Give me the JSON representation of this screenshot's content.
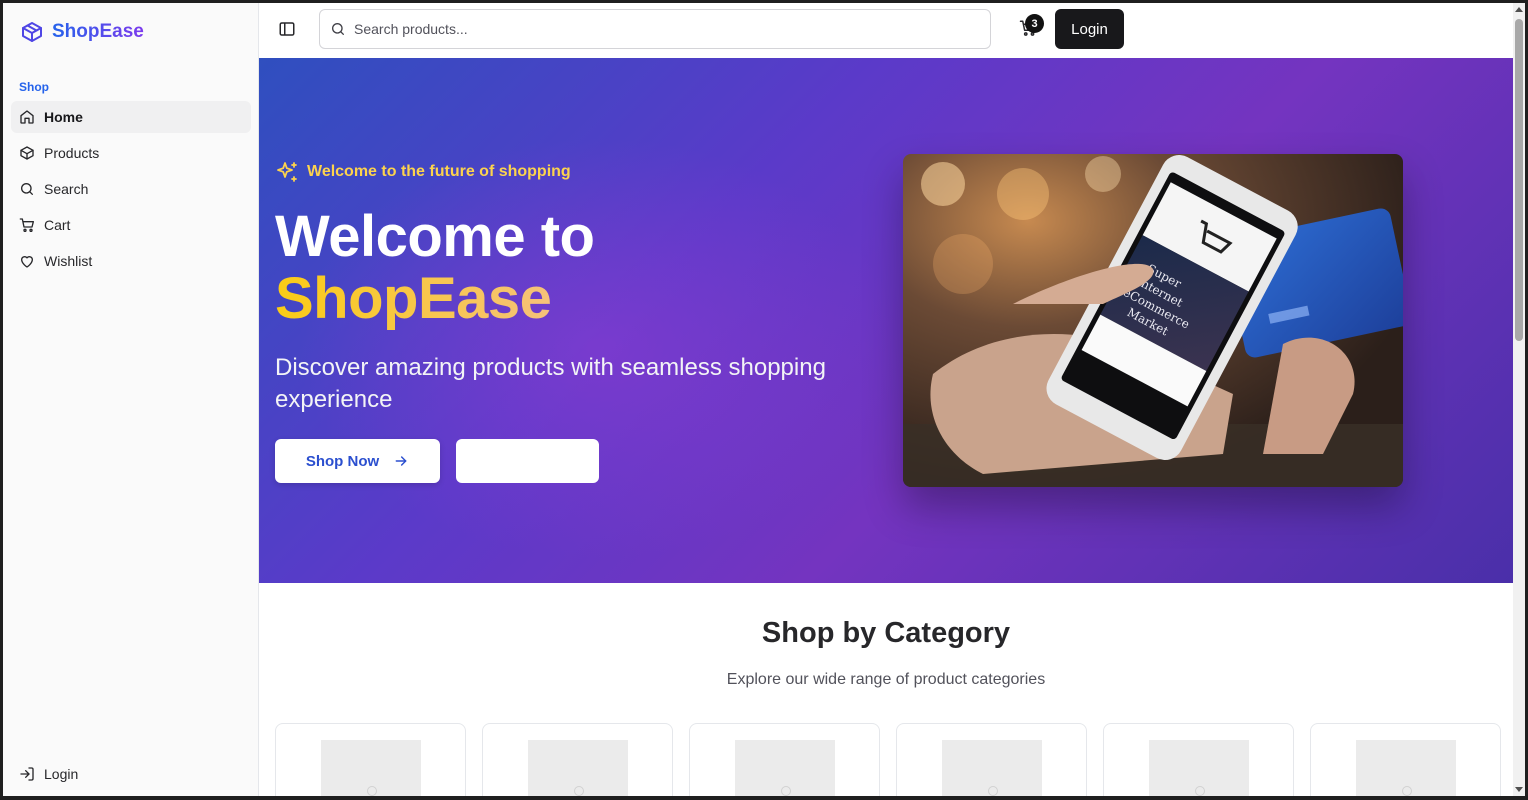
{
  "sidebar": {
    "brand": "ShopEase",
    "group_label": "Shop",
    "items": [
      {
        "label": "Home",
        "icon": "home-icon",
        "active": true
      },
      {
        "label": "Products",
        "icon": "box-icon",
        "active": false
      },
      {
        "label": "Search",
        "icon": "search-icon",
        "active": false
      },
      {
        "label": "Cart",
        "icon": "cart-icon",
        "active": false
      },
      {
        "label": "Wishlist",
        "icon": "heart-icon",
        "active": false
      }
    ],
    "footer_login": "Login"
  },
  "header": {
    "search_placeholder": "Search products...",
    "cart_count": "3",
    "login_label": "Login"
  },
  "hero": {
    "tagline": "Welcome to the future of shopping",
    "title_line1": "Welcome to",
    "title_line2": "ShopEase",
    "subtitle": "Discover amazing products with seamless shopping experience",
    "primary_button": "Shop Now",
    "secondary_button": "",
    "image_alt": "Hand holding smartphone showing eCommerce market app with credit card"
  },
  "categories": {
    "title": "Shop by Category",
    "subtitle": "Explore our wide range of product categories",
    "count": 6
  },
  "colors": {
    "brand": "#4f46e5",
    "accent_yellow": "#fcd34d",
    "primary_blue": "#2b4fcf",
    "hero_gradient_start": "#2f4fbf",
    "hero_gradient_mid": "#7434c0",
    "dark_button": "#18181b"
  }
}
